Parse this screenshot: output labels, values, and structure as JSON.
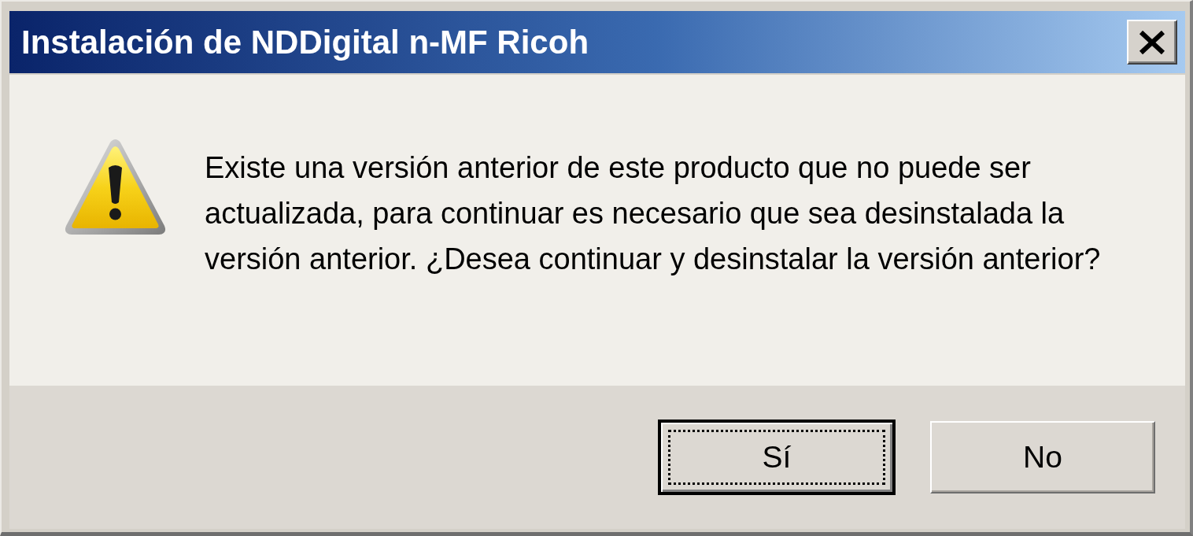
{
  "window": {
    "title": "Instalación de NDDigital n-MF Ricoh"
  },
  "message": "Existe una versión anterior de este producto que no puede ser actualizada, para continuar es necesario que sea desinstalada la versión anterior. ¿Desea continuar y desinstalar la versión anterior?",
  "buttons": [
    {
      "label": "Sí",
      "default": true
    },
    {
      "label": "No",
      "default": false
    }
  ]
}
